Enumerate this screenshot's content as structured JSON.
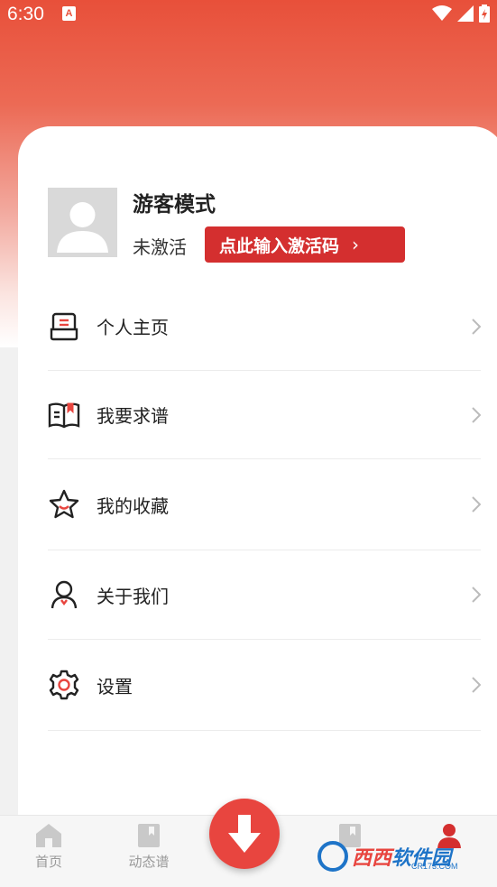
{
  "status_bar": {
    "time": "6:30",
    "notification_badge": "A"
  },
  "profile": {
    "username": "游客模式",
    "status_label": "未激活",
    "activate_button": "点此输入激活码",
    "activate_chevron": "›"
  },
  "menu": {
    "items": [
      {
        "label": "个人主页",
        "icon": "profile-page-icon"
      },
      {
        "label": "我要求谱",
        "icon": "book-icon"
      },
      {
        "label": "我的收藏",
        "icon": "star-icon"
      },
      {
        "label": "关于我们",
        "icon": "user-icon"
      },
      {
        "label": "设置",
        "icon": "gear-icon"
      }
    ]
  },
  "tabbar": {
    "tabs": [
      {
        "label": "首页",
        "icon": "home-icon"
      },
      {
        "label": "动态谱",
        "icon": "score-icon"
      },
      {
        "label": "",
        "icon": "download-icon"
      },
      {
        "label": "",
        "icon": "library-icon"
      },
      {
        "label": "",
        "icon": "user-icon"
      }
    ]
  },
  "watermark": {
    "brand_a": "西西",
    "brand_b": "软件园",
    "sub": "CR173.COM"
  },
  "colors": {
    "accent": "#d42f2f",
    "header_gradient_top": "#e8503a",
    "fab": "#e8453f",
    "watermark_blue": "#1e74c8"
  }
}
